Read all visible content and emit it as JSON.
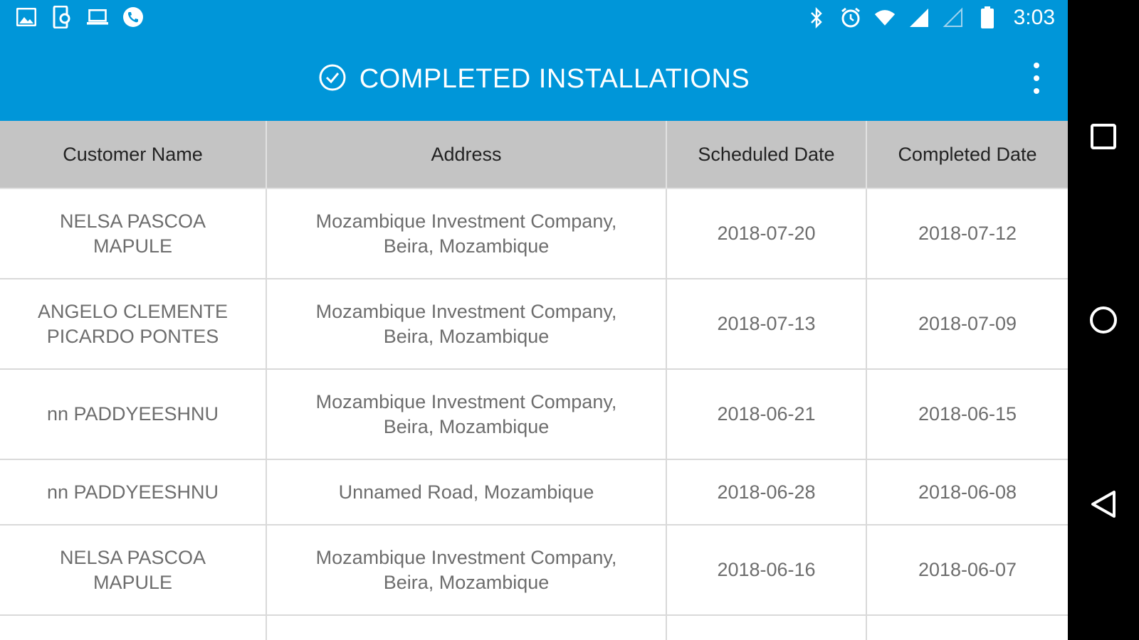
{
  "status_bar": {
    "left_icons": [
      "image-icon",
      "phone-settings-icon",
      "laptop-icon",
      "call-icon"
    ],
    "right_icons": [
      "bluetooth-icon",
      "alarm-icon",
      "wifi-icon",
      "signal-icon",
      "signal-empty-icon",
      "battery-icon"
    ],
    "time": "3:03"
  },
  "app_bar": {
    "title_icon": "check-circle-icon",
    "title": "COMPLETED INSTALLATIONS",
    "menu_icon": "more-vert-icon"
  },
  "table": {
    "headers": [
      "Customer Name",
      "Address",
      "Scheduled Date",
      "Completed Date"
    ],
    "rows": [
      {
        "customer": "NELSA PASCOA MAPULE",
        "address": "Mozambique Investment Company, Beira, Mozambique",
        "scheduled": "2018-07-20",
        "completed": "2018-07-12"
      },
      {
        "customer": "ANGELO  CLEMENTE PICARDO PONTES",
        "address": "Mozambique Investment Company, Beira, Mozambique",
        "scheduled": "2018-07-13",
        "completed": "2018-07-09"
      },
      {
        "customer": "nn PADDYEESHNU",
        "address": "Mozambique Investment Company, Beira, Mozambique",
        "scheduled": "2018-06-21",
        "completed": "2018-06-15"
      },
      {
        "customer": "nn PADDYEESHNU",
        "address": "Unnamed Road, Mozambique",
        "scheduled": "2018-06-28",
        "completed": "2018-06-08"
      },
      {
        "customer": "NELSA PASCOA MAPULE",
        "address": "Mozambique Investment Company, Beira, Mozambique",
        "scheduled": "2018-06-16",
        "completed": "2018-06-07"
      }
    ]
  },
  "nav_bar": {
    "buttons": [
      "recents-square-icon",
      "home-circle-icon",
      "back-triangle-icon"
    ]
  },
  "colors": {
    "accent": "#0096d9",
    "header_bg": "#c4c4c4",
    "cell_text": "#6d6d6d",
    "nav_bg": "#000000"
  }
}
